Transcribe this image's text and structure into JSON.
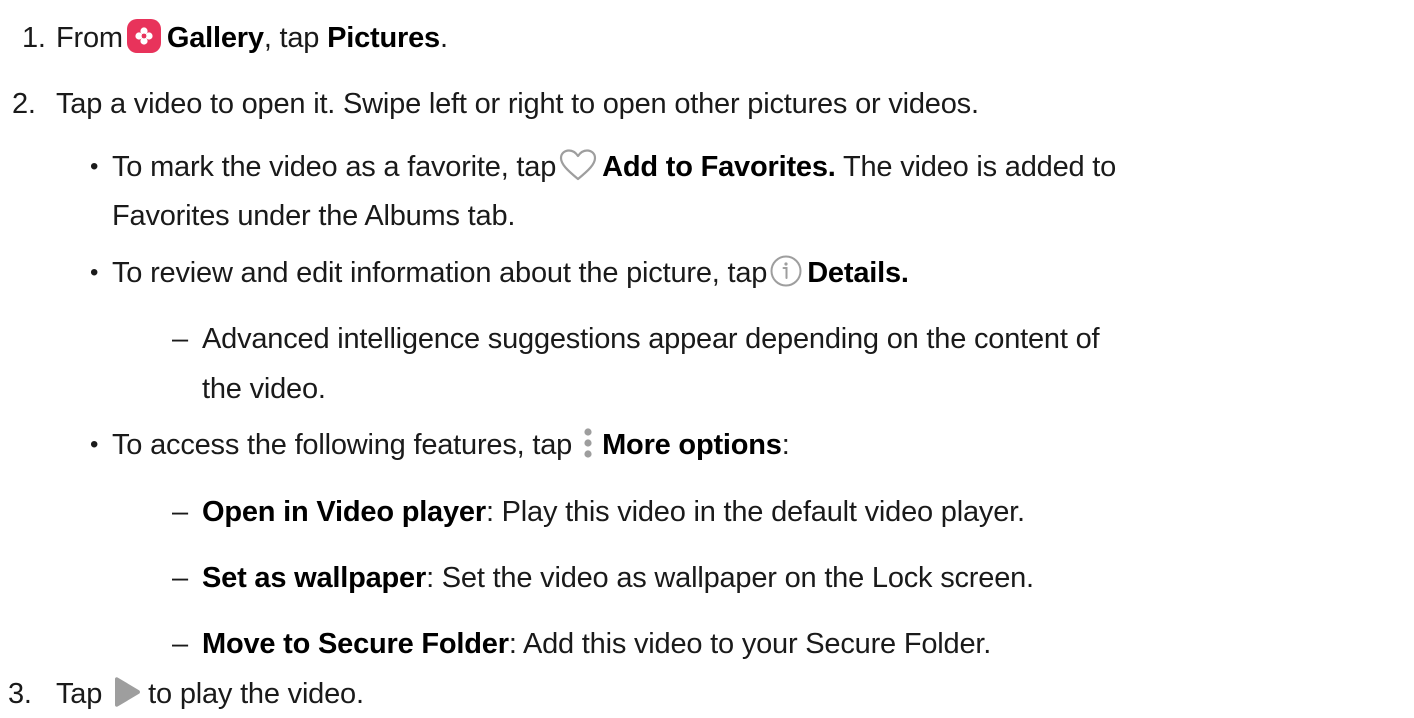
{
  "steps": [
    {
      "number": "1.",
      "prefix": "From",
      "gallery": "Gallery",
      "middle": ", tap",
      "pictures": "Pictures",
      "suffix": "."
    },
    {
      "number": "2.",
      "text": "Tap a video to open it. Swipe left or right to open other pictures or videos."
    },
    {
      "number": "3.",
      "prefix": "Tap",
      "suffix": "to play the video."
    }
  ],
  "bullets": {
    "favorite": {
      "prefix": "To mark the video as a favorite, tap",
      "action": "Add to Favorites.",
      "suffix": "The video is added to",
      "line2": "Favorites under the Albums tab."
    },
    "details": {
      "prefix": "To review and edit information about the picture, tap",
      "action": "Details."
    },
    "advanced": {
      "line1": "Advanced intelligence suggestions appear depending on the content of",
      "line2": "the video."
    },
    "more": {
      "prefix": "To access the following features, tap",
      "action": "More options",
      "suffix": ":"
    }
  },
  "sub_items": [
    {
      "label": "Open in Video player",
      "text": ": Play this video in the default video player."
    },
    {
      "label": "Set as wallpaper",
      "text": ": Set the video as wallpaper on the Lock screen."
    },
    {
      "label": "Move to Secure Folder",
      "text": ": Add this video to your Secure Folder."
    }
  ],
  "bullet_glyph": "•",
  "dash_glyph": "–",
  "icons": {
    "gallery": "gallery-icon",
    "heart": "heart-outline-icon",
    "info": "info-circle-icon",
    "more": "more-options-vertical-dots-icon",
    "play": "play-triangle-icon"
  },
  "colors": {
    "gallery_icon_bg": "#e8335b",
    "icon_gray": "#9e9e9e",
    "text": "#1a1a1a"
  }
}
